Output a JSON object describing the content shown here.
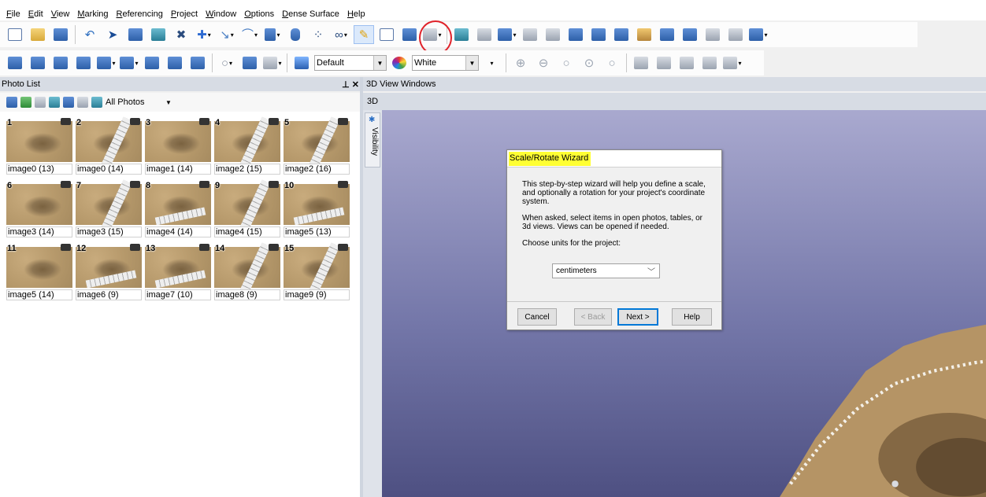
{
  "menu": [
    "File",
    "Edit",
    "View",
    "Marking",
    "Referencing",
    "Project",
    "Window",
    "Options",
    "Dense Surface",
    "Help"
  ],
  "toolbar2": {
    "style_combo": "Default",
    "color_combo": "White"
  },
  "photo_panel": {
    "title": "Photo List",
    "pin": "  x",
    "filter": "All Photos",
    "photos": [
      {
        "num": "1",
        "label": "image0 (13)"
      },
      {
        "num": "2",
        "label": "image0 (14)"
      },
      {
        "num": "3",
        "label": "image1 (14)"
      },
      {
        "num": "4",
        "label": "image2 (15)"
      },
      {
        "num": "5",
        "label": "image2 (16)"
      },
      {
        "num": "6",
        "label": "image3 (14)"
      },
      {
        "num": "7",
        "label": "image3 (15)"
      },
      {
        "num": "8",
        "label": "image4 (14)"
      },
      {
        "num": "9",
        "label": "image4 (15)"
      },
      {
        "num": "10",
        "label": "image5 (13)"
      },
      {
        "num": "11",
        "label": "image5 (14)"
      },
      {
        "num": "12",
        "label": "image6 (9)"
      },
      {
        "num": "13",
        "label": "image7 (10)"
      },
      {
        "num": "14",
        "label": "image8 (9)"
      },
      {
        "num": "15",
        "label": "image9 (9)"
      }
    ]
  },
  "view": {
    "header": "3D View Windows",
    "tab": "3D",
    "visibility": "Visibility"
  },
  "wizard": {
    "title": "Scale/Rotate Wizard",
    "p1": "This step-by-step wizard will help you define a scale, and optionally a rotation for your project's coordinate system.",
    "p2": "When asked, select items in open photos, tables, or 3d views. Views can be opened if needed.",
    "p3": "Choose units for the project:",
    "units": "centimeters",
    "cancel": "Cancel",
    "back": "< Back",
    "next": "Next >",
    "help": "Help"
  },
  "colors": {
    "title_highlight": "#ffff33",
    "annotation_circle": "#e0222a",
    "viewport_top": "#a9a9cf",
    "viewport_bottom": "#4e5082"
  }
}
